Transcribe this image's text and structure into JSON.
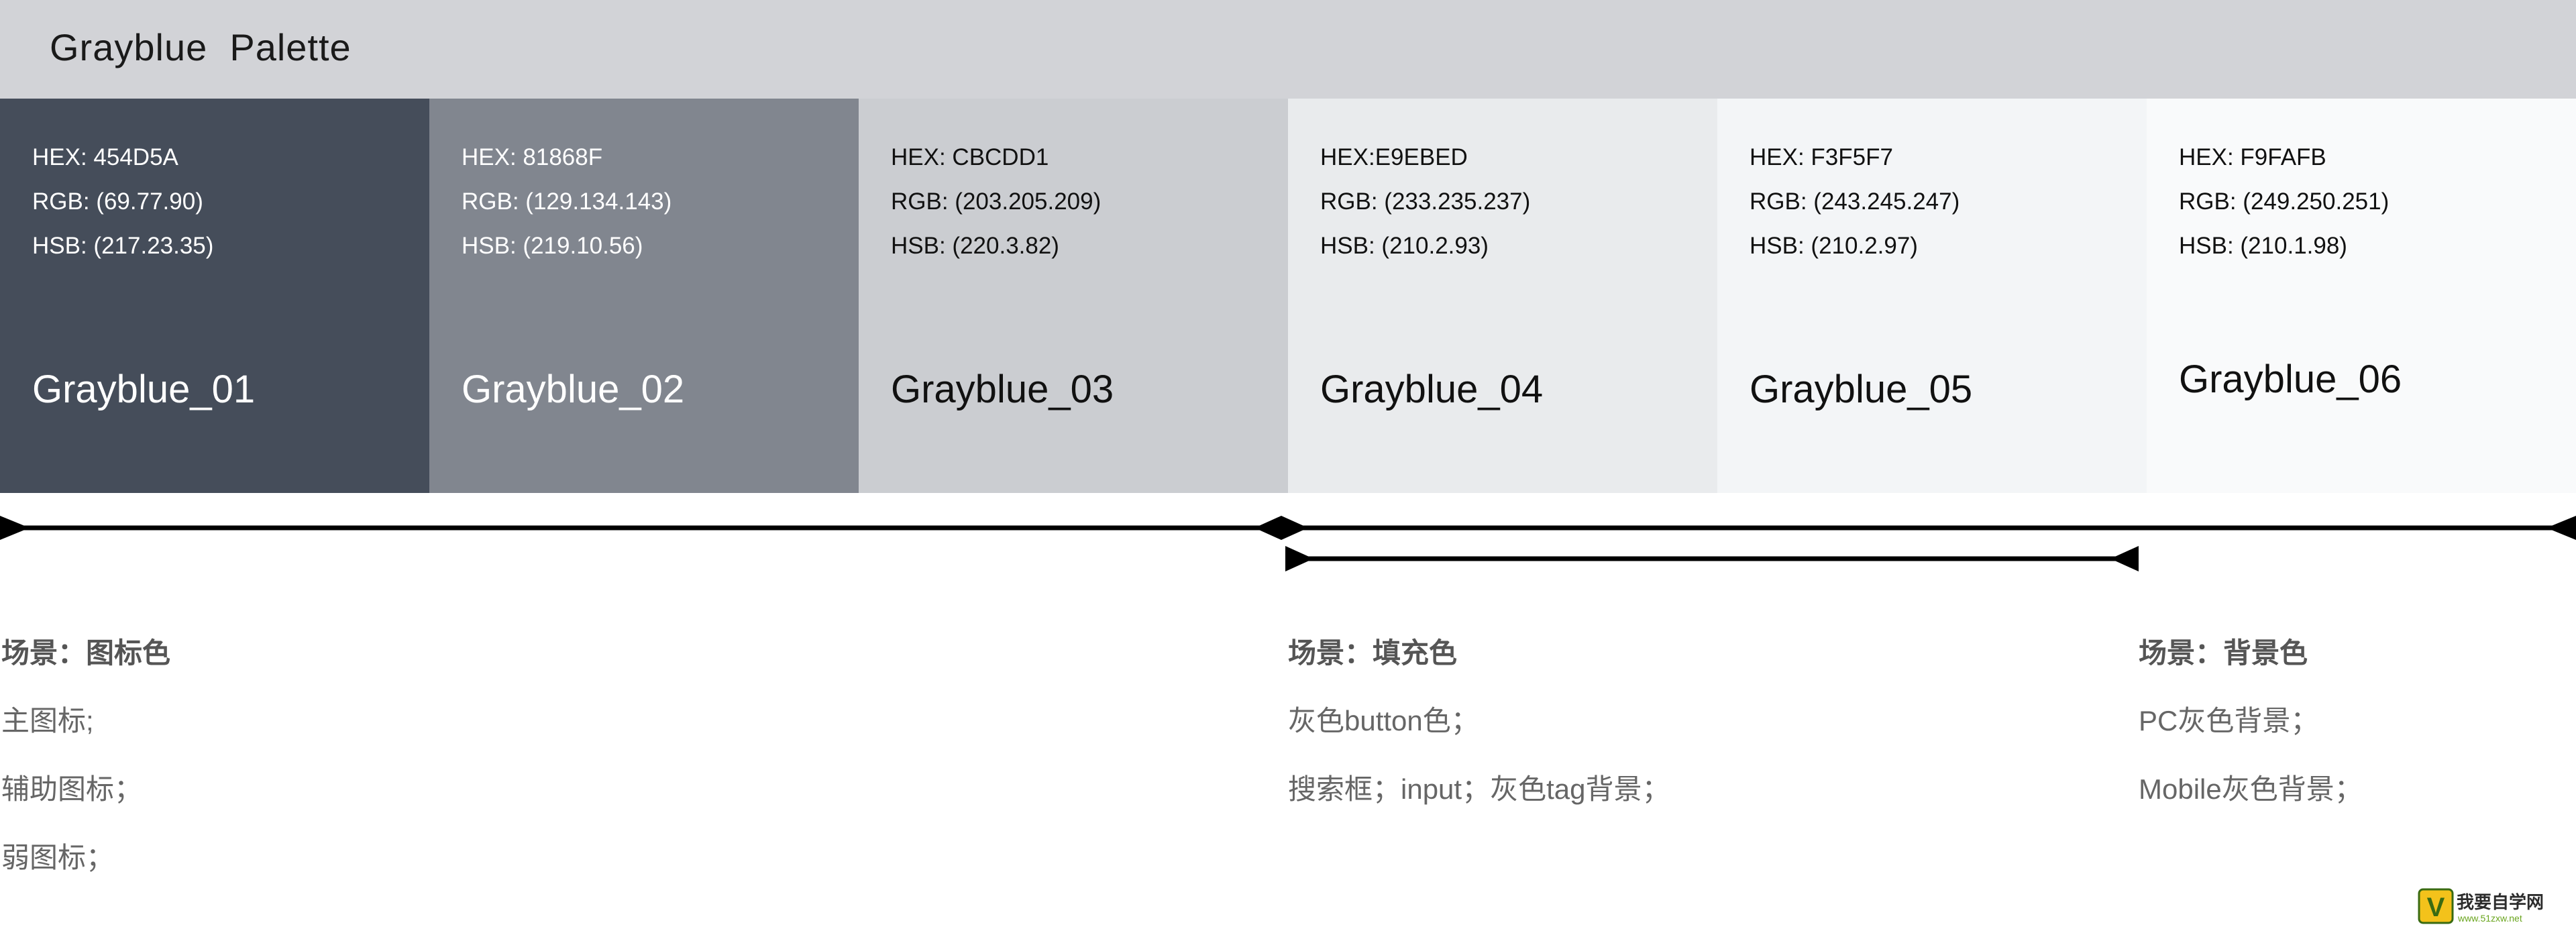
{
  "header": {
    "title": "Grayblue  Palette"
  },
  "swatches": [
    {
      "hex_line": "HEX: 454D5A",
      "rgb_line": "RGB: (69.77.90)",
      "hsb_line": "HSB: (217.23.35)",
      "name": "Grayblue_01",
      "color": "#454D5A",
      "text_color": "#ffffff"
    },
    {
      "hex_line": "HEX: 81868F",
      "rgb_line": "RGB: (129.134.143)",
      "hsb_line": "HSB: (219.10.56)",
      "name": "Grayblue_02",
      "color": "#81868F",
      "text_color": "#ffffff"
    },
    {
      "hex_line": "HEX: CBCDD1",
      "rgb_line": "RGB: (203.205.209)",
      "hsb_line": "HSB: (220.3.82)",
      "name": "Grayblue_03",
      "color": "#CBCDD1",
      "text_color": "#111111"
    },
    {
      "hex_line": "HEX:E9EBED",
      "rgb_line": "RGB: (233.235.237)",
      "hsb_line": "HSB: (210.2.93)",
      "name": "Grayblue_04",
      "color": "#E9EBED",
      "text_color": "#111111"
    },
    {
      "hex_line": "HEX: F3F5F7",
      "rgb_line": "RGB: (243.245.247)",
      "hsb_line": "HSB: (210.2.97)",
      "name": "Grayblue_05",
      "color": "#F3F5F7",
      "text_color": "#111111"
    },
    {
      "hex_line": "HEX: F9FAFB",
      "rgb_line": "RGB: (249.250.251)",
      "hsb_line": "HSB: (210.1.98)",
      "name": "Grayblue_06",
      "color": "#F9FAFB",
      "text_color": "#111111"
    }
  ],
  "scenarios": [
    {
      "title": "场景：图标色",
      "items": [
        "主图标;",
        "辅助图标；",
        "弱图标；"
      ]
    },
    {
      "title": "场景：填充色",
      "items": [
        "灰色button色；",
        "搜索框；input；灰色tag背景；"
      ]
    },
    {
      "title": "场景：背景色",
      "items": [
        "PC灰色背景；",
        "Mobile灰色背景；"
      ]
    }
  ],
  "watermark": {
    "text": "我要自学网",
    "url_text": "www.51zxw.net"
  }
}
